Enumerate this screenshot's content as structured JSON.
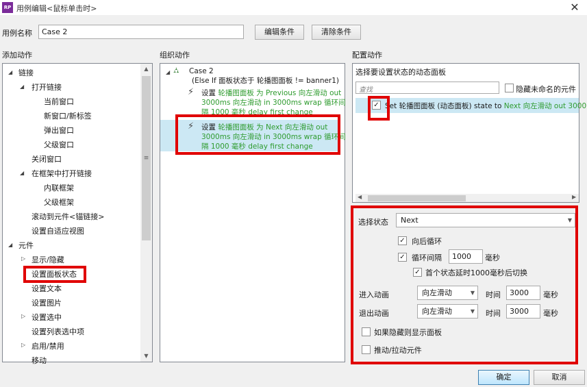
{
  "window": {
    "logo_text": "RP",
    "title": "用例编辑<鼠标单击时>",
    "close_glyph": "✕"
  },
  "case": {
    "name_label": "用例名称",
    "name_value": "Case 2",
    "edit_condition": "编辑条件",
    "clear_condition": "清除条件"
  },
  "sections": {
    "add_action": "添加动作",
    "organize_action": "组织动作",
    "config_action": "配置动作"
  },
  "add_action_tree": {
    "items": [
      "链接",
      "打开链接",
      "当前窗口",
      "新窗口/新标签",
      "弹出窗口",
      "父级窗口",
      "关闭窗口",
      "在框架中打开链接",
      "内联框架",
      "父级框架",
      "滚动到元件<锚链接>",
      "设置自适应视图",
      "元件",
      "显示/隐藏",
      "设置面板状态",
      "设置文本",
      "设置图片",
      "设置选中",
      "设置列表选中项",
      "启用/禁用",
      "移动"
    ]
  },
  "organize": {
    "case_title": "Case 2",
    "condition": "(Else If 面板状态于 轮播图面板 != banner1)",
    "action1": {
      "prefix": "设置 ",
      "line1_green": "轮播图面板 为 Previous 向左滑动 out",
      "line2": "3000ms 向左滑动 in 3000ms wrap 循环间",
      "line3": "隔 1000 毫秒 delay first change"
    },
    "action2": {
      "prefix": "设置 ",
      "line1_green": "轮播图面板 为 Next 向左滑动 out",
      "line2": "3000ms 向左滑动 in 3000ms wrap 循环间",
      "line3": "隔 1000 毫秒 delay first change"
    }
  },
  "config": {
    "select_panel_title": "选择要设置状态的动态面板",
    "search_placeholder": "查找",
    "hide_unnamed": "隐藏未命名的元件",
    "panel_row": {
      "check": "✓",
      "prefix": "Set 轮播图面板 (动态面板) state to ",
      "suffix_green": "Next 向左滑动 out 3000"
    },
    "select_state_label": "选择状态",
    "select_state_value": "Next",
    "loop_back": "向后循环",
    "loop_interval": "循环间隔",
    "loop_interval_value": "1000",
    "ms": "毫秒",
    "first_delay": "首个状态延时1000毫秒后切换",
    "enter_anim_label": "进入动画",
    "enter_anim_value": "向左滑动",
    "time_label": "时间",
    "enter_time": "3000",
    "exit_anim_label": "退出动画",
    "exit_anim_value": "向左滑动",
    "exit_time": "3000",
    "show_if_hidden": "如果隐藏则显示面板",
    "push_widgets": "推动/拉动元件"
  },
  "buttons": {
    "ok": "确定",
    "cancel": "取消"
  },
  "colors": {
    "highlight_red": "#e00000",
    "selection_blue": "#cce8f4",
    "action_green": "#2e9b2e"
  }
}
